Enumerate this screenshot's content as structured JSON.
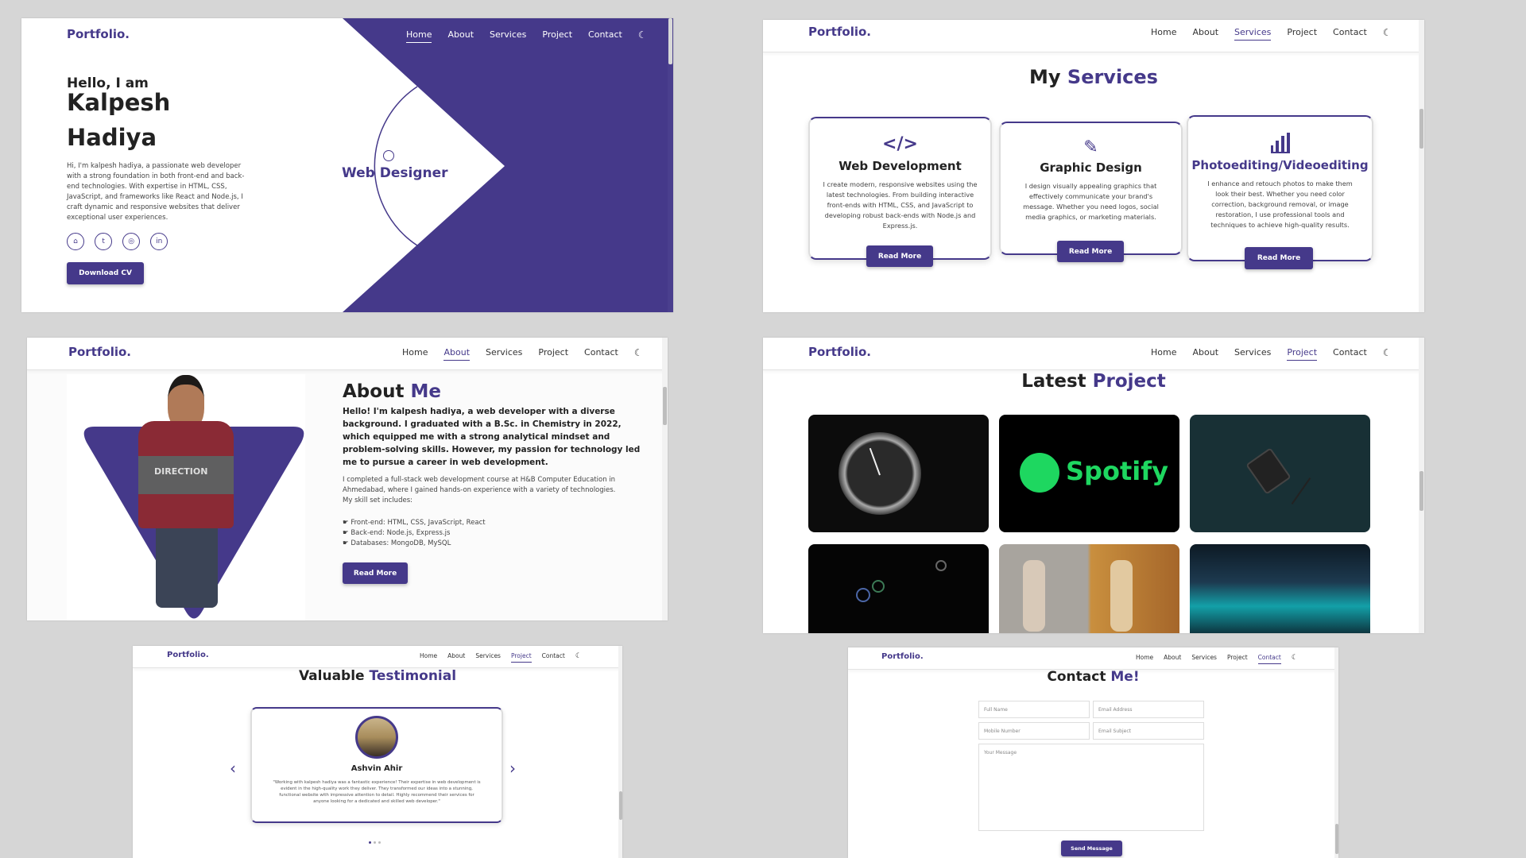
{
  "brand": {
    "logo": "Portfolio.",
    "accent": "#45398a"
  },
  "nav": {
    "home": "Home",
    "about": "About",
    "services": "Services",
    "project": "Project",
    "contact": "Contact",
    "theme_icon": "moon-icon"
  },
  "hero": {
    "greeting": "Hello, I am",
    "first_name": "Kalpesh",
    "last_name": "Hadiya",
    "bio_lines": [
      "Hi, I'm kalpesh hadiya, a passionate web developer",
      "with a strong foundation in both front-end and back-",
      "end technologies. With expertise in HTML, CSS,",
      "JavaScript, and frameworks like React and Node.js, I",
      "craft dynamic and responsive websites that deliver",
      "exceptional user experiences."
    ],
    "socials": [
      "github-icon",
      "twitter-icon",
      "instagram-icon",
      "linkedin-icon"
    ],
    "download": "Download CV",
    "role_label": "Web Designer",
    "role_icon": "palette-icon"
  },
  "services": {
    "heading_a": "My",
    "heading_b": "Services",
    "cards": [
      {
        "icon": "code-icon",
        "title": "Web Development",
        "lines": [
          "I create modern, responsive websites using the",
          "latest technologies. From building interactive",
          "front-ends with HTML, CSS, and JavaScript to",
          "developing robust back-ends with Node.js and",
          "Express.js."
        ],
        "button": "Read More"
      },
      {
        "icon": "brush-icon",
        "title": "Graphic Design",
        "lines": [
          "I design visually appealing graphics that",
          "effectively communicate your brand's",
          "message. Whether you need logos, social",
          "media graphics, or marketing materials."
        ],
        "button": "Read More"
      },
      {
        "icon": "bar-chart-icon",
        "title": "Photoediting/Videoediting",
        "lines": [
          "I enhance and retouch photos to make them",
          "look their best. Whether you need color",
          "correction, background removal, or image",
          "restoration, I use professional tools and",
          "techniques to achieve high-quality results."
        ],
        "button": "Read More"
      }
    ]
  },
  "about": {
    "heading_a": "About",
    "heading_b": "Me",
    "bold_lines": [
      "Hello! I'm kalpesh hadiya, a web developer with a diverse",
      "background. I graduated with a B.Sc. in Chemistry in 2022,",
      "which equipped me with a strong analytical mindset and",
      "problem-solving skills. However, my passion for technology led",
      "me to pursue a career in web development."
    ],
    "para_lines": [
      "I completed a full-stack web development course at H&B Computer Education in",
      "Ahmedabad, where I gained hands-on experience with a variety of technologies.",
      "My skill set includes:"
    ],
    "skills": [
      "Front-end: HTML, CSS, JavaScript, React",
      "Back-end: Node.js, Express.js",
      "Databases: MongoDB, MySQL"
    ],
    "button": "Read More",
    "shirt_text": "DIRECTION"
  },
  "projects": {
    "heading_a": "Latest",
    "heading_b": "Project",
    "spotify": "Spotify"
  },
  "testimonial": {
    "heading_a": "Valuable",
    "heading_b": "Testimonial",
    "name": "Ashvin Ahir",
    "quote_lines": [
      "\"Working with kalpesh hadiya was a fantastic experience! Their expertise in web development is",
      "evident in the high-quality work they deliver. They transformed our ideas into a stunning,",
      "functional website with impressive attention to detail. Highly recommend their services for",
      "anyone looking for a dedicated and skilled web developer.\""
    ]
  },
  "contact": {
    "heading_a": "Contact",
    "heading_b": "Me!",
    "full_name": "Full Name",
    "email": "Email Address",
    "mobile": "Mobile Number",
    "subject": "Email Subject",
    "message": "Your Message",
    "send": "Send Message"
  }
}
